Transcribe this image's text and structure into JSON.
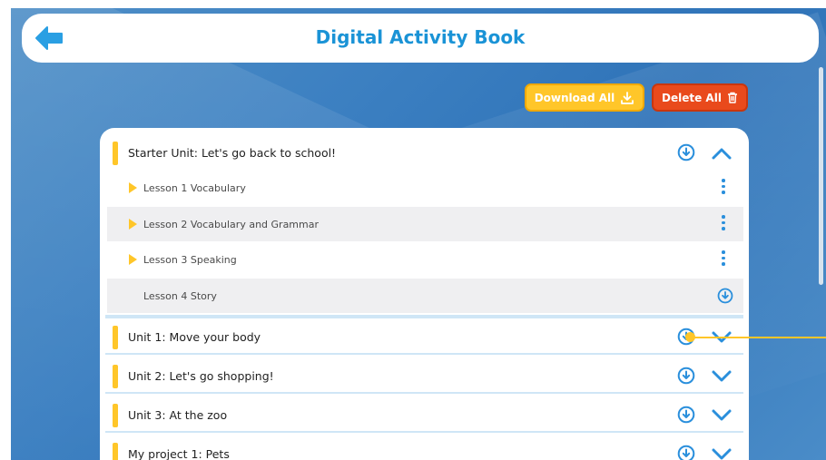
{
  "header": {
    "title": "Digital Activity Book"
  },
  "actions": {
    "download_all": "Download All",
    "delete_all": "Delete All"
  },
  "starter_unit": {
    "label": "Starter Unit: Let's go back to school!",
    "lessons": [
      {
        "label": "Lesson 1 Vocabulary"
      },
      {
        "label": "Lesson 2 Vocabulary and Grammar"
      },
      {
        "label": "Lesson 3 Speaking"
      },
      {
        "label": "Lesson 4 Story"
      }
    ]
  },
  "units": [
    {
      "label": "Unit 1: Move your body"
    },
    {
      "label": "Unit 2: Let's go shopping!"
    },
    {
      "label": "Unit 3: At the zoo"
    },
    {
      "label": "My project 1: Pets"
    }
  ],
  "colors": {
    "accent_blue": "#2a8fdc",
    "title_blue": "#1a93d6",
    "yellow": "#ffc629",
    "red": "#e94a1c"
  }
}
